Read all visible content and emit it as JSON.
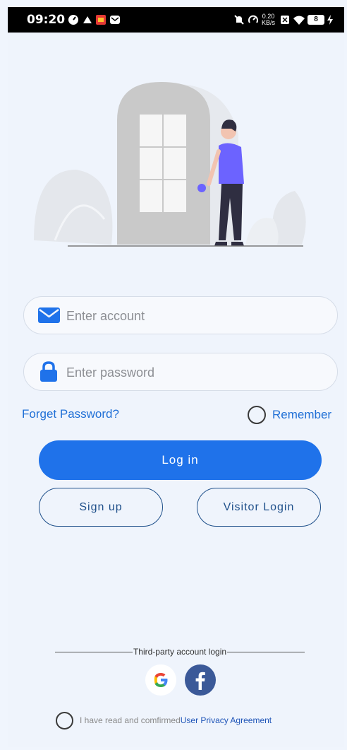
{
  "status_bar": {
    "time": "09:20",
    "net_speed": "0.20",
    "net_unit": "KB/s",
    "battery": "8"
  },
  "login": {
    "account_placeholder": "Enter account",
    "password_placeholder": "Enter password",
    "forget_label": "Forget Password?",
    "remember_label": "Remember",
    "login_label": "Log in",
    "signup_label": "Sign up",
    "visitor_label": "Visitor Login"
  },
  "third_party": {
    "title": "Third-party account login"
  },
  "agreement": {
    "text": "I have read and comfirmed",
    "link": "User Privacy Agreement"
  },
  "icons": {
    "account": "mail-icon",
    "password": "lock-icon",
    "google": "google-icon",
    "facebook": "facebook-icon"
  },
  "colors": {
    "accent": "#1f72ea",
    "link": "#1f6fd6",
    "outline": "#1e4f8a",
    "background": "#eff4fc"
  }
}
